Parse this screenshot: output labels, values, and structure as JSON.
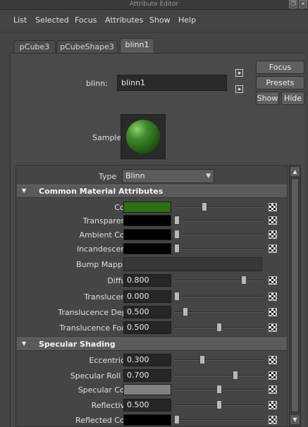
{
  "window": {
    "title": "Attribute Editor"
  },
  "menu": [
    "List",
    "Selected",
    "Focus",
    "Attributes",
    "Show",
    "Help"
  ],
  "tabs": [
    {
      "label": "pCube3",
      "active": false
    },
    {
      "label": "pCubeShape3",
      "active": false
    },
    {
      "label": "blinn1",
      "active": true
    }
  ],
  "node": {
    "label": "blinn:",
    "name": "blinn1"
  },
  "buttons": {
    "focus": "Focus",
    "presets": "Presets",
    "show": "Show",
    "hide": "Hide"
  },
  "sample": {
    "label": "Sample",
    "sphere_color": "#3f8a2c"
  },
  "type": {
    "label": "Type",
    "value": "Blinn"
  },
  "sections": {
    "common": "Common Material Attributes",
    "specular": "Specular Shading"
  },
  "common_attributes": [
    {
      "label": "Color",
      "kind": "color",
      "swatch": "#2e6f14",
      "slider": 0.33
    },
    {
      "label": "Transparency",
      "kind": "color",
      "swatch": "#000000",
      "slider": 0.0
    },
    {
      "label": "Ambient Color",
      "kind": "color",
      "swatch": "#000000",
      "slider": 0.0
    },
    {
      "label": "Incandescence",
      "kind": "color",
      "swatch": "#000000",
      "slider": 0.0
    },
    {
      "label": "Bump Mapping",
      "kind": "map"
    },
    {
      "label": "Diffuse",
      "kind": "number",
      "value": "0.800",
      "slider": 0.8
    },
    {
      "label": "Translucence",
      "kind": "number",
      "value": "0.000",
      "slider": 0.0
    },
    {
      "label": "Translucence Depth",
      "kind": "number",
      "value": "0.500",
      "slider": 0.1
    },
    {
      "label": "Translucence Focus",
      "kind": "number",
      "value": "0.500",
      "slider": 0.5
    }
  ],
  "specular_attributes": [
    {
      "label": "Eccentricity",
      "kind": "number",
      "value": "0.300",
      "slider": 0.3
    },
    {
      "label": "Specular Roll Off",
      "kind": "number",
      "value": "0.700",
      "slider": 0.7
    },
    {
      "label": "Specular Color",
      "kind": "color",
      "swatch": "#808080",
      "slider": 0.5
    },
    {
      "label": "Reflectivity",
      "kind": "number",
      "value": "0.500",
      "slider": 0.5
    },
    {
      "label": "Reflected Color",
      "kind": "color",
      "swatch": "#000000",
      "slider": 0.0
    }
  ]
}
